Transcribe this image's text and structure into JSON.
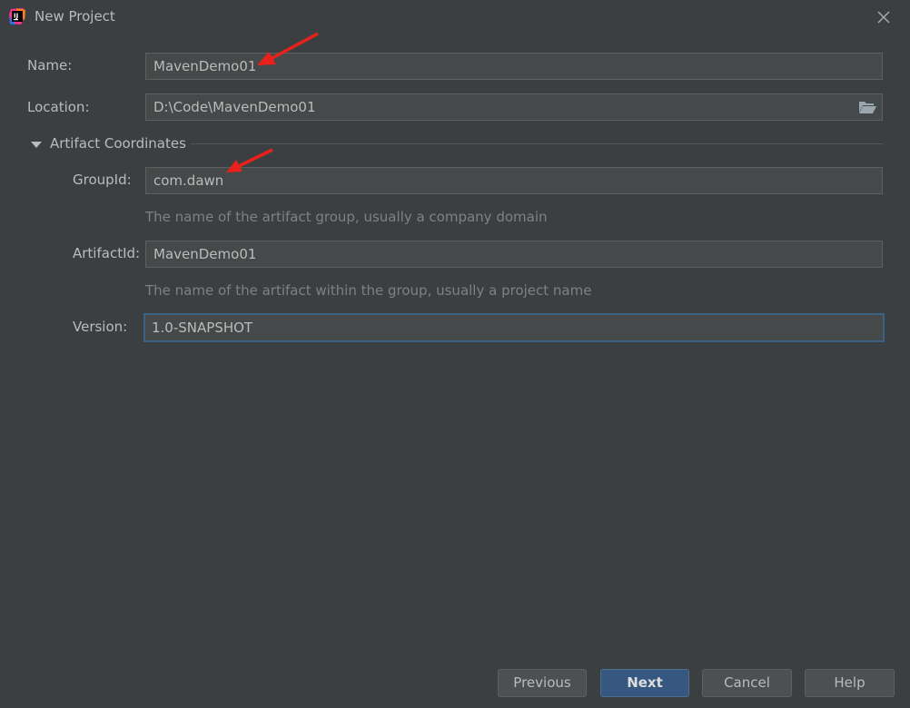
{
  "window": {
    "title": "New Project",
    "app_icon": "intellij-idea-icon",
    "close_icon": "close-icon"
  },
  "form": {
    "name_label": "Name:",
    "name_value": "MavenDemo01",
    "location_label": "Location:",
    "location_value": "D:\\Code\\MavenDemo01",
    "browse_icon": "folder-open-icon"
  },
  "artifact_section": {
    "title": "Artifact Coordinates",
    "expanded": true,
    "groupid_label": "GroupId:",
    "groupid_value": "com.dawn",
    "groupid_hint": "The name of the artifact group, usually a company domain",
    "artifactid_label": "ArtifactId:",
    "artifactid_value": "MavenDemo01",
    "artifactid_hint": "The name of the artifact within the group, usually a project name",
    "version_label": "Version:",
    "version_value": "1.0-SNAPSHOT"
  },
  "buttons": {
    "previous": "Previous",
    "next": "Next",
    "cancel": "Cancel",
    "help": "Help"
  },
  "colors": {
    "background": "#3c3f41",
    "field_background": "#45494a",
    "focus_border": "#3d6185",
    "primary_button": "#365880",
    "annotation_arrow": "#e8221a"
  }
}
